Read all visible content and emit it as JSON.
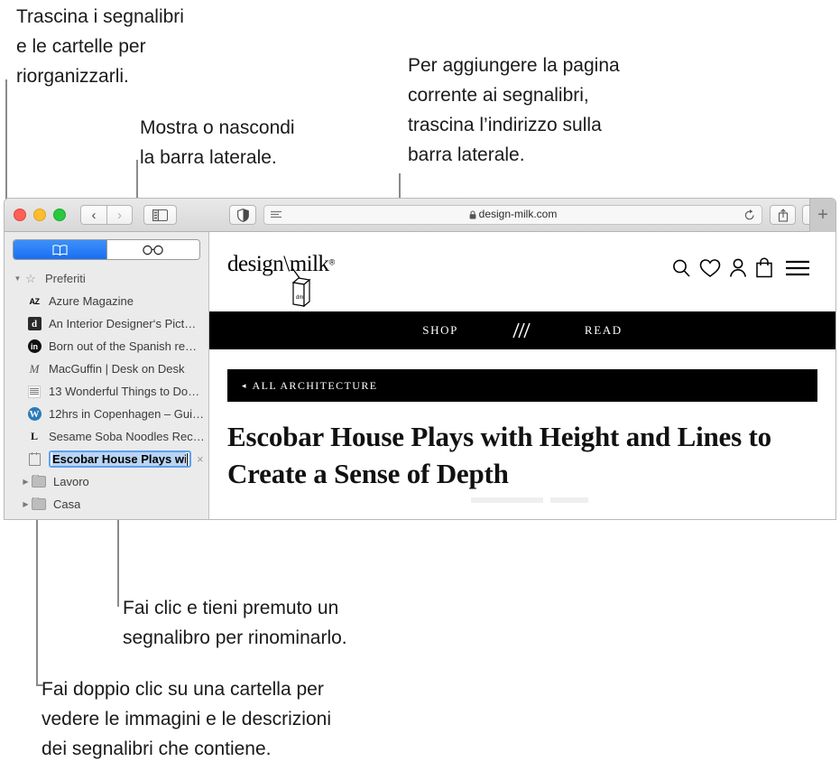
{
  "callouts": [
    {
      "id": "reorder",
      "text": "Trascina i segnalibri\ne le cartelle per\nriorganizzarli."
    },
    {
      "id": "show-hide-sidebar",
      "text": "Mostra o nascondi\nla barra laterale."
    },
    {
      "id": "add-bookmark",
      "text": "Per aggiungere la pagina\ncorrente ai segnalibri,\ntrascina l’indirizzo sulla\nbarra laterale."
    },
    {
      "id": "rename-bookmark",
      "text": "Fai clic e tieni premuto un\nsegnalibro per rinominarlo."
    },
    {
      "id": "open-folder",
      "text": "Fai doppio clic su una cartella per\nvedere le immagini e le descrizioni\ndei segnalibri che contiene."
    }
  ],
  "browser": {
    "toolbar": {
      "back_label": "‹",
      "forward_label": "›",
      "sidebar_toggle_name": "sidebar-toggle",
      "privacy_report_name": "shield-icon",
      "reader_name": "reader-view-icon",
      "url": "design-milk.com",
      "url_lock": "lock-icon",
      "reload_name": "reload-icon",
      "share_name": "share-icon",
      "tab_overview_name": "tab-overview-icon",
      "new_tab_label": "+"
    },
    "sidebar": {
      "segments": [
        {
          "id": "bookmarks",
          "icon": "book-icon",
          "active": true
        },
        {
          "id": "reading-list",
          "icon": "glasses-icon",
          "active": false
        }
      ],
      "groups": [
        {
          "label": "Preferiti",
          "icon": "star-icon",
          "expanded": true,
          "items": [
            {
              "label": "Azure Magazine",
              "favicon": "az"
            },
            {
              "label": "An Interior Designer‘s Pict…",
              "favicon": "d"
            },
            {
              "label": "Born out of the Spanish re…",
              "favicon": "in"
            },
            {
              "label": "MacGuffin | Desk on Desk",
              "favicon": "m"
            },
            {
              "label": "13 Wonderful Things to Do…",
              "favicon": "grid"
            },
            {
              "label": "12hrs in Copenhagen – Gui…",
              "favicon": "wp"
            },
            {
              "label": "Sesame Soba Noodles Rec…",
              "favicon": "l"
            }
          ]
        }
      ],
      "editing_row": {
        "favicon": "bag",
        "value": "Escobar House Plays with ",
        "delete_label": "×"
      },
      "folders": [
        {
          "label": "Lavoro",
          "icon": "folder-icon"
        },
        {
          "label": "Casa",
          "icon": "folder-icon"
        }
      ]
    },
    "webpage": {
      "logo_text": "design\\milk",
      "logo_registered": "®",
      "carton_label": "dm",
      "header_icons": [
        "search-icon",
        "heart-icon",
        "account-icon",
        "shopping-bag-icon",
        "hamburger-menu-icon"
      ],
      "nav": [
        {
          "label": "SHOP"
        },
        {
          "label": ""
        },
        {
          "label": "READ"
        }
      ],
      "category_bar": {
        "arrow": "◂",
        "label": "ALL ARCHITECTURE"
      },
      "headline": "Escobar House Plays with Height and Lines to Create a Sense of Depth"
    }
  }
}
